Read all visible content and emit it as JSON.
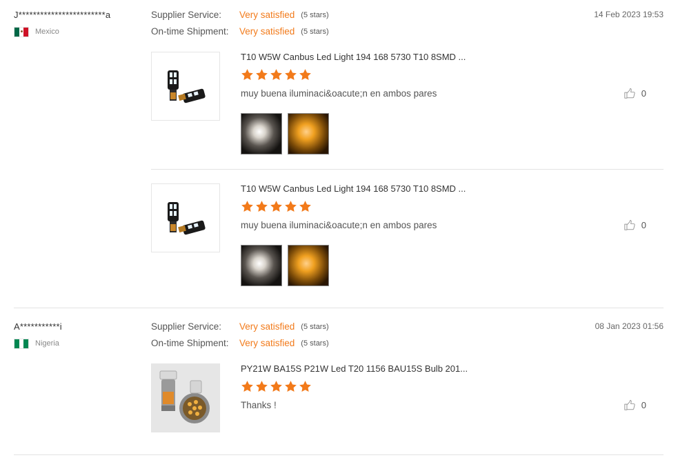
{
  "labels": {
    "supplier_service": "Supplier Service:",
    "ontime_shipment": "On-time Shipment:"
  },
  "colors": {
    "accent": "#f27a1a",
    "text": "#333333",
    "muted": "#888888"
  },
  "reviews": [
    {
      "user": "J************************a",
      "country": "Mexico",
      "flag": [
        "#006847",
        "#ffffff",
        "#ce1126"
      ],
      "date": "14 Feb 2023 19:53",
      "supplier_service": {
        "value": "Very satisfied",
        "stars": "(5 stars)"
      },
      "ontime_shipment": {
        "value": "Very satisfied",
        "stars": "(5 stars)"
      },
      "items": [
        {
          "title": "T10 W5W Canbus Led Light 194 168 5730 T10 8SMD ...",
          "rating": 5,
          "comment": "muy buena iluminaci&oacute;n  en ambos pares",
          "likes": "0",
          "thumb_icon": "t10-led-bulb-image"
        },
        {
          "title": "T10 W5W Canbus Led Light 194 168 5730 T10 8SMD ...",
          "rating": 5,
          "comment": "muy buena iluminaci&oacute;n  en ambos pares",
          "likes": "0",
          "thumb_icon": "t10-led-bulb-image"
        }
      ]
    },
    {
      "user": "A***********i",
      "country": "Nigeria",
      "flag": [
        "#008751",
        "#ffffff",
        "#008751"
      ],
      "date": "08 Jan 2023 01:56",
      "supplier_service": {
        "value": "Very satisfied",
        "stars": "(5 stars)"
      },
      "ontime_shipment": {
        "value": "Very satisfied",
        "stars": "(5 stars)"
      },
      "items": [
        {
          "title": "PY21W BA15S P21W Led T20 1156 BAU15S Bulb 201...",
          "rating": 5,
          "comment": "Thanks !",
          "likes": "0",
          "thumb_icon": "py21w-led-bulb-image"
        }
      ]
    }
  ]
}
